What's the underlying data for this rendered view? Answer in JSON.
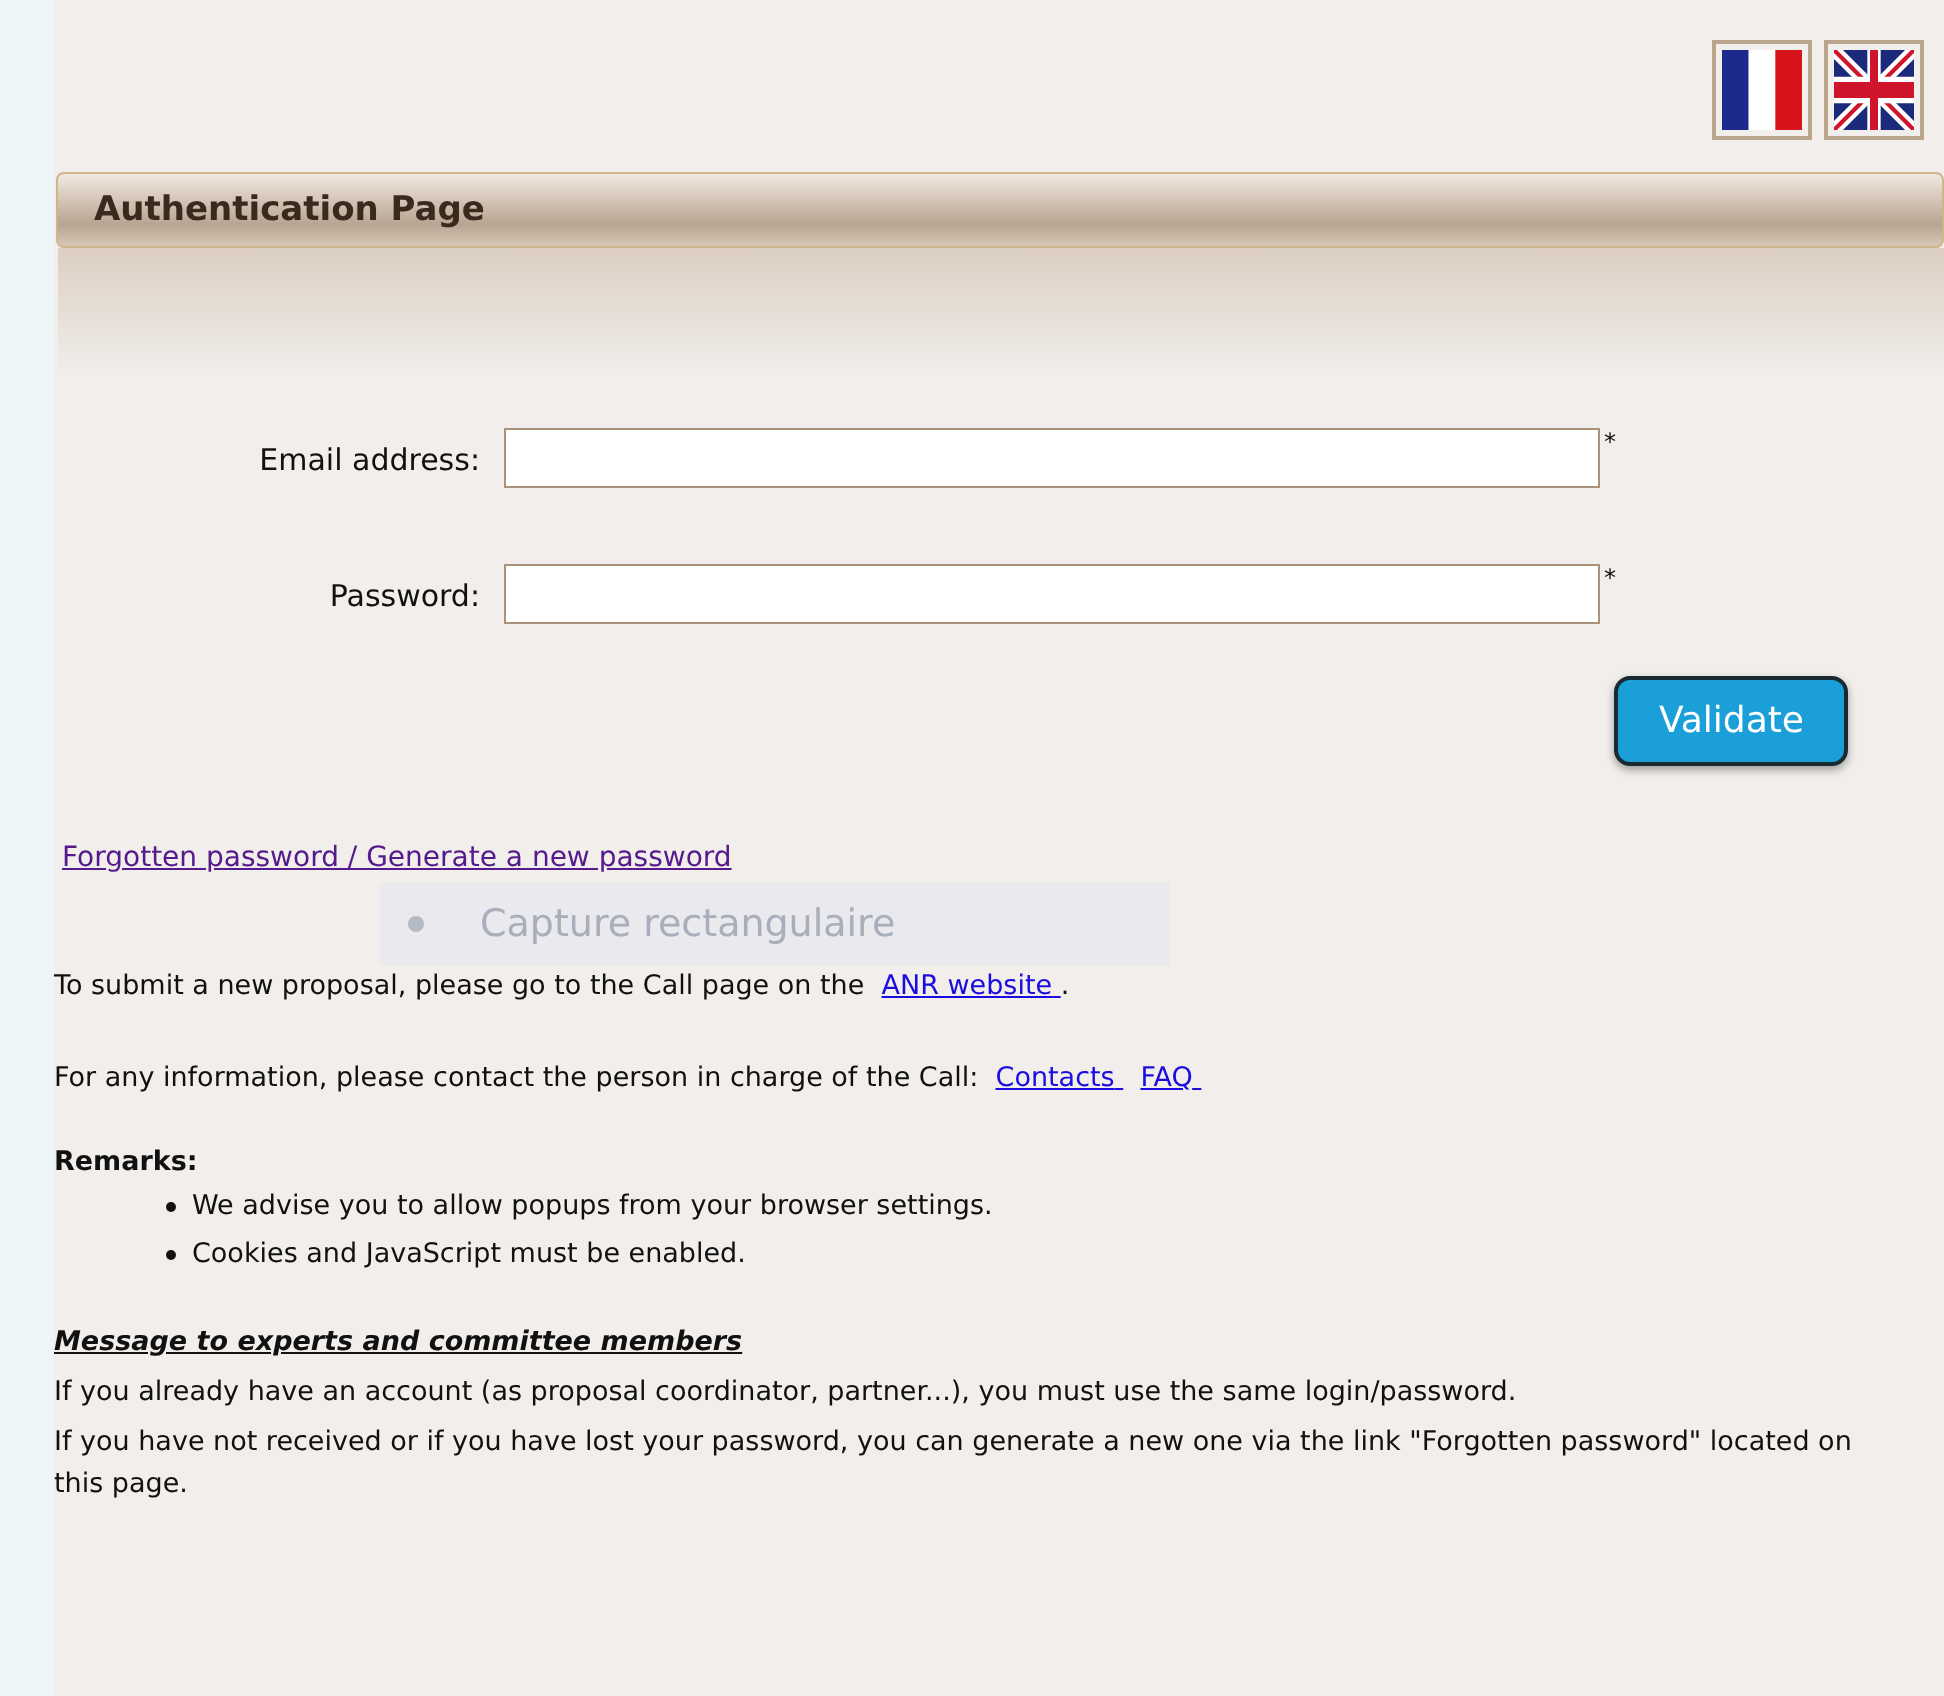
{
  "languages": [
    {
      "kind": "fr"
    },
    {
      "kind": "uk"
    }
  ],
  "header": {
    "title": "Authentication Page"
  },
  "fields": [
    {
      "label": "Email address:",
      "required_mark": "*"
    },
    {
      "label": "Password:",
      "required_mark": "*"
    }
  ],
  "submit_button": "Validate",
  "forgot_link": {
    "label": "Forgotten password / Generate a new password",
    "visited": true
  },
  "capture_overlay": {
    "label": "Capture rectangulaire"
  },
  "info_lines": [
    {
      "text": "To submit a new proposal, please go to the Call page on the",
      "links": [
        {
          "label": "ANR website",
          "visited": false
        }
      ],
      "suffix": "."
    },
    {
      "text": "For any information, please contact the person in charge of the Call:",
      "links": [
        {
          "label": "Contacts",
          "visited": false
        },
        {
          "label": "FAQ",
          "visited": false
        }
      ]
    }
  ],
  "remarks": {
    "title": "Remarks:",
    "items": [
      "We advise you to allow popups from your browser settings.",
      "Cookies and JavaScript must be enabled."
    ]
  },
  "message": {
    "title": "Message to experts and committee members",
    "lines": [
      "If you already have an account (as proposal coordinator, partner...), you must use the same login/password.",
      "If you have not received or if you have lost your password, you can generate a new one via the link \"Forgotten password\" located on this page."
    ]
  }
}
